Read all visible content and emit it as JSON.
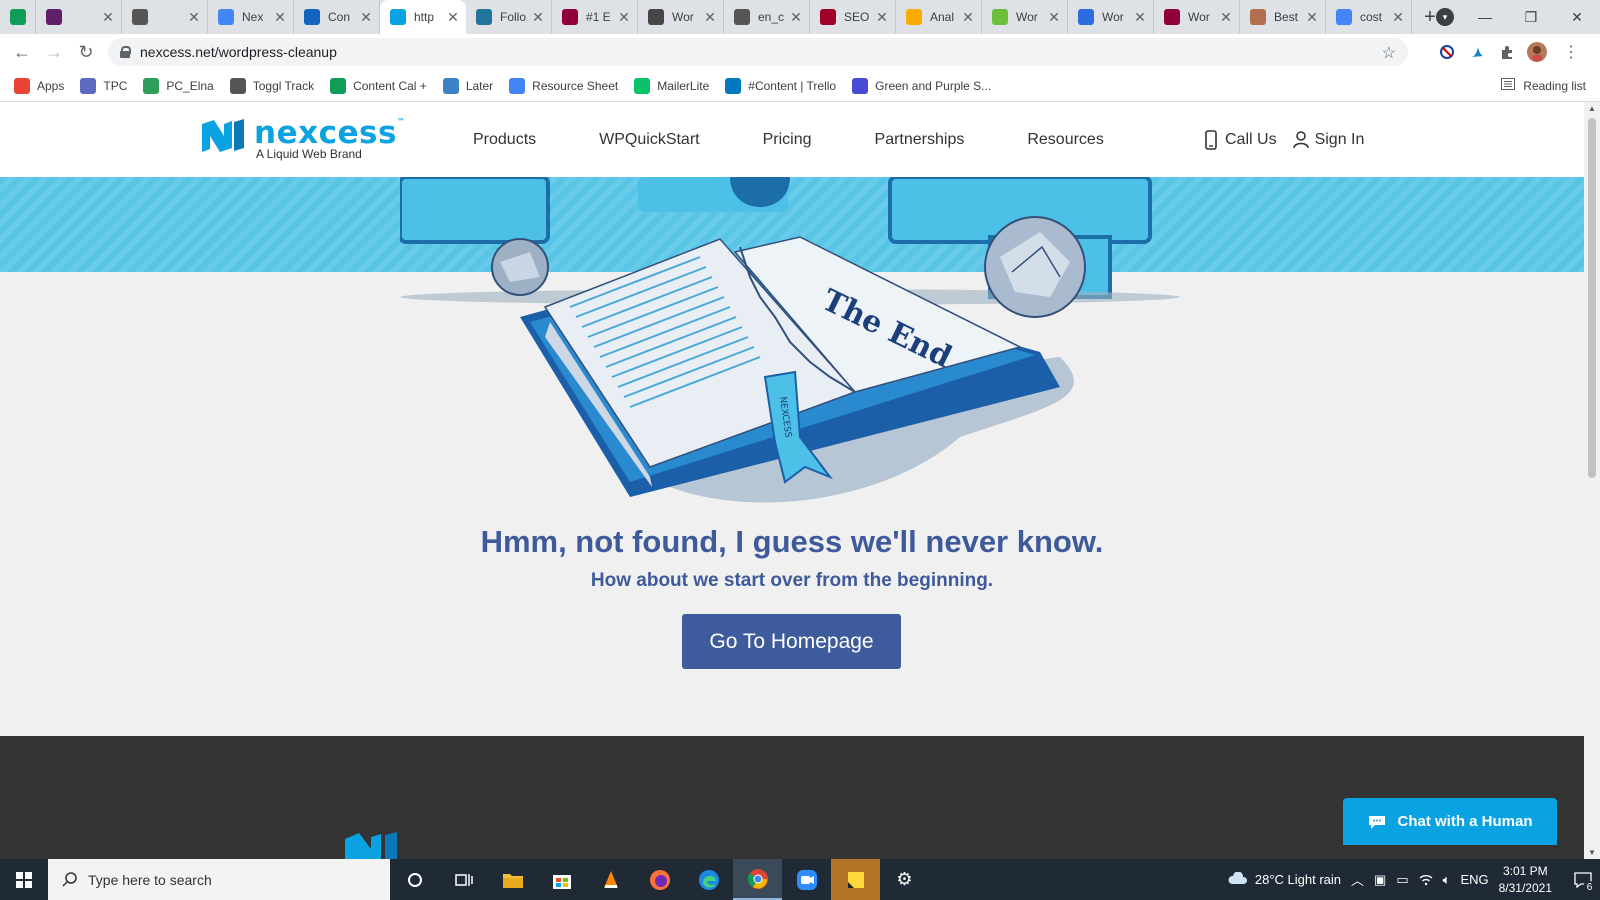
{
  "browser": {
    "tabs": [
      {
        "title": "",
        "favicon": "sheets-icon",
        "color": "#0f9d58"
      },
      {
        "title": "",
        "favicon": "slack-icon",
        "color": "#611f69"
      },
      {
        "title": "",
        "favicon": "toggl-icon",
        "color": "#555555"
      },
      {
        "title": "Nex",
        "favicon": "docs-icon",
        "color": "#4285f4"
      },
      {
        "title": "Con",
        "favicon": "c-icon",
        "color": "#1565c0"
      },
      {
        "title": "http",
        "favicon": "nexcess-icon",
        "color": "#0aa2e0",
        "active": true
      },
      {
        "title": "Follo",
        "favicon": "wordpress-icon",
        "color": "#21759b"
      },
      {
        "title": "#1 E",
        "favicon": "elementor-icon",
        "color": "#92003b"
      },
      {
        "title": "Wor",
        "favicon": "wordpress-icon",
        "color": "#464646"
      },
      {
        "title": "en_c",
        "favicon": "globe-icon",
        "color": "#555555"
      },
      {
        "title": "SEO",
        "favicon": "seo-icon",
        "color": "#a0002a"
      },
      {
        "title": "Anal",
        "favicon": "analytics-icon",
        "color": "#f9ab00"
      },
      {
        "title": "Wor",
        "favicon": "green-circle-icon",
        "color": "#6cbf3a"
      },
      {
        "title": "Wor",
        "favicon": "s-icon",
        "color": "#2d6cdf"
      },
      {
        "title": "Wor",
        "favicon": "elementor-icon",
        "color": "#92003b"
      },
      {
        "title": "Best",
        "favicon": "face-icon",
        "color": "#b07050"
      },
      {
        "title": "cost",
        "favicon": "google-icon",
        "color": "#4285f4"
      }
    ],
    "url": "nexcess.net/wordpress-cleanup",
    "bookmarks": [
      {
        "label": "Apps",
        "icon": "apps-grid-icon",
        "color": "#ea4335"
      },
      {
        "label": "TPC",
        "icon": "m-icon",
        "color": "#5c6bc0"
      },
      {
        "label": "PC_Elna",
        "icon": "t-icon",
        "color": "#2e9e5b"
      },
      {
        "label": "Toggl Track",
        "icon": "toggl-icon",
        "color": "#555555"
      },
      {
        "label": "Content Cal +",
        "icon": "sheets-icon",
        "color": "#0f9d58"
      },
      {
        "label": "Later",
        "icon": "later-icon",
        "color": "#3c82c4"
      },
      {
        "label": "Resource Sheet",
        "icon": "docs-icon",
        "color": "#4285f4"
      },
      {
        "label": "MailerLite",
        "icon": "mailerlite-icon",
        "color": "#09c269"
      },
      {
        "label": "#Content | Trello",
        "icon": "trello-icon",
        "color": "#0079bf"
      },
      {
        "label": "Green and Purple S...",
        "icon": "canva-icon",
        "color": "#4a4ad8"
      }
    ],
    "reading_list": "Reading list"
  },
  "site": {
    "logo_word": "nexcess",
    "logo_tm": "™",
    "logo_sub": "A Liquid Web Brand",
    "nav": [
      "Products",
      "WPQuickStart",
      "Pricing",
      "Partnerships",
      "Resources"
    ],
    "call_us": "Call Us",
    "sign_in": "Sign In",
    "book_text": "The End",
    "book_ribbon": "NEXCESS",
    "headline": "Hmm, not found, I guess we'll never know.",
    "subhead": "How about we start over from the beginning.",
    "cta": "Go To Homepage",
    "chat": "Chat with a Human",
    "colors": {
      "brand": "#0aa2e0",
      "heading": "#3e5a9b",
      "button": "#3e5b9b",
      "footer": "#333333"
    }
  },
  "taskbar": {
    "search_placeholder": "Type here to search",
    "weather": "28°C  Light rain",
    "language": "ENG",
    "time": "3:01 PM",
    "date": "8/31/2021",
    "notifications": "6"
  }
}
